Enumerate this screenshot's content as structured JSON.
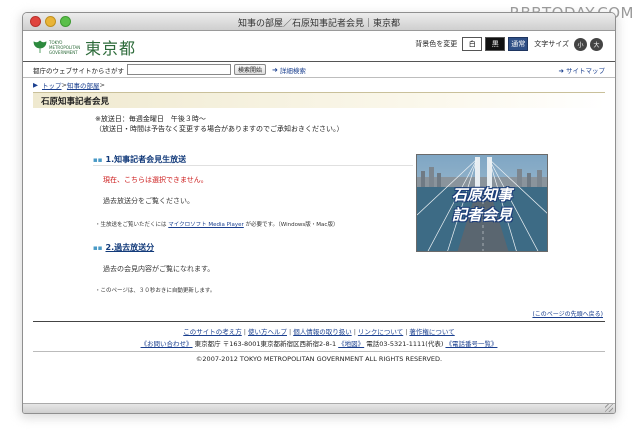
{
  "watermark": "RBBTODAY.COM",
  "window": {
    "title": "知事の部屋／石原知事記者会見｜東京都"
  },
  "header": {
    "logo_small": "TOKYO METROPOLITAN GOVERNMENT",
    "logo_big": "東京都",
    "bg_label": "背景色を変更",
    "bg_white": "白",
    "bg_black": "黒",
    "bg_normal": "通常",
    "size_label": "文字サイズ",
    "size_small": "小",
    "size_large": "大"
  },
  "search": {
    "label": "都庁のウェブサイトからさがす",
    "value": "",
    "button": "検索開始",
    "advanced": "詳細検索",
    "sitemap": "サイトマップ"
  },
  "breadcrumb": {
    "top": "トップ",
    "sep": ">",
    "room": "知事の部屋",
    "trail_end": ">"
  },
  "page": {
    "title": "石原知事記者会見",
    "notice_line1": "※放送日：毎週金曜日　午後３時〜",
    "notice_line2": "（放送日・時間は予告なく変更する場合がありますのでご承知おきください。）"
  },
  "sections": {
    "live_title": "1.知事記者会見生放送",
    "live_unavailable": "現在、こちらは選択できません。",
    "live_past": "過去放送分をご覧ください。",
    "note_pre": "・生放送をご覧いただくには",
    "note_link": "マイクロソフト Media Player",
    "note_post": "が必要です。（Windows版・Mac版）",
    "past_title": "2.過去放送分",
    "past_text": "過去の会見内容がご覧になれます。",
    "reload_note": "・このページは、３０秒おきに自動更新します。"
  },
  "thumbnail": {
    "line1": "石原知事",
    "line2": "記者会見"
  },
  "footer": {
    "page_top": "(このページの先頭へ戻る)",
    "links": [
      "このサイトの考え方",
      "使い方ヘルプ",
      "個人情報の取り扱い",
      "リンクについて",
      "著作権について"
    ],
    "contact": "《お問い合わせ》",
    "address": "東京都庁 〒163-8001東京都新宿区西新宿2-8-1",
    "map": "《地図》",
    "phone": "電話03-5321-1111(代表)",
    "phonelist": "《電話番号一覧》",
    "copyright": "©2007-2012 TOKYO METROPOLITAN GOVERNMENT ALL RIGHTS RESERVED."
  },
  "colors": {
    "link": "#1a3f8f",
    "warning": "#cc1a1a",
    "title_bar": "#efe9cf",
    "logo_green": "#2d6b3a"
  }
}
